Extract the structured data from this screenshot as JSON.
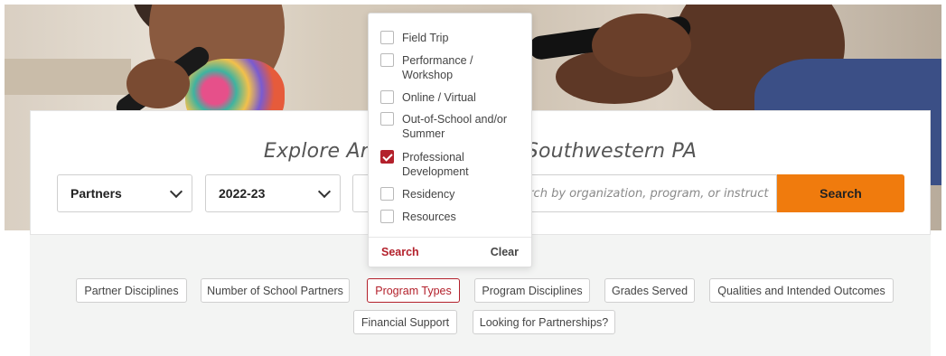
{
  "hero": {
    "headline": "Explore Arts Education in Southwestern PA"
  },
  "search": {
    "type_select": "Partners",
    "year_select": "2022-23",
    "placeholder": "Search by organization, program, or instructor",
    "button_label": "Search"
  },
  "filters": [
    "Partner Disciplines",
    "Number of School Partners",
    "Program Types",
    "Program Disciplines",
    "Grades Served",
    "Qualities and Intended Outcomes",
    "Financial Support",
    "Looking for Partnerships?"
  ],
  "dropdown": {
    "options": [
      {
        "label": "Field Trip",
        "checked": false
      },
      {
        "label": "Performance / Workshop",
        "checked": false
      },
      {
        "label": "Online / Virtual",
        "checked": false
      },
      {
        "label": "Out-of-School and/or Summer",
        "checked": false
      },
      {
        "label": "Professional Development",
        "checked": true
      },
      {
        "label": "Residency",
        "checked": false
      },
      {
        "label": "Resources",
        "checked": false
      }
    ],
    "search_label": "Search",
    "clear_label": "Clear"
  },
  "colors": {
    "accent_orange": "#f07b0d",
    "accent_red": "#b3202b"
  }
}
